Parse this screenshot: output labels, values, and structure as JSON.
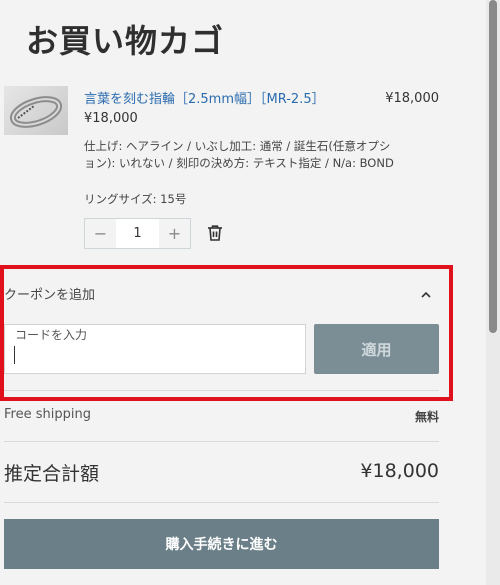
{
  "page": {
    "title": "お買い物カゴ"
  },
  "cart": {
    "item": {
      "name": "言葉を刻む指輪［2.5mm幅］［MR-2.5］",
      "unit_price": "¥18,000",
      "line_total": "¥18,000",
      "options": "仕上げ: ヘアライン / いぶし加工: 通常 / 誕生石(任意オプション): いれない / 刻印の決め方: テキスト指定 / N/a: BOND",
      "ring_size": "リングサイズ: 15号",
      "quantity": "1",
      "minus_symbol": "−",
      "plus_symbol": "+"
    }
  },
  "coupon": {
    "title": "クーポンを追加",
    "input_label": "コードを入力",
    "apply_label": "適用"
  },
  "summary": {
    "shipping_label": "Free shipping",
    "shipping_value": "無料",
    "total_label": "推定合計額",
    "total_value": "¥18,000"
  },
  "checkout": {
    "label": "購入手続きに進む"
  },
  "icons": {
    "trash": "trash-icon",
    "chevron": "chevron-up-icon"
  },
  "colors": {
    "accent": "#6b7f88",
    "highlight": "#e0101d",
    "link": "#2b6cb0"
  }
}
